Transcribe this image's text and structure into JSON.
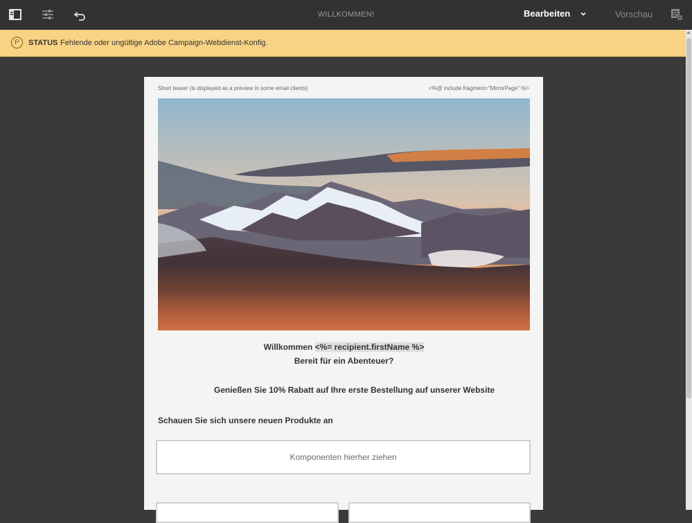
{
  "toolbar": {
    "title": "WILLKOMMEN!",
    "edit_label": "Bearbeiten",
    "preview_label": "Vorschau",
    "icons": [
      "sidebar-toggle-icon",
      "properties-sliders-icon",
      "undo-icon",
      "chevron-down-icon",
      "side-panel-icon"
    ]
  },
  "status": {
    "label": "STATUS",
    "message": "Fehlende oder ungültige Adobe Campaign-Webdienst-Konfig."
  },
  "email": {
    "teaser": "Short teaser (is displayed as a preview in some email clients)",
    "mirror": "<%@ include fragment=\"MirrorPage\" %>",
    "greeting_prefix": "Willkommen",
    "greeting_token": "<%= recipient.firstName %>",
    "subtitle": "Bereit für ein Abenteuer?",
    "discount": "Genießen Sie 10% Rabatt auf Ihre erste Bestellung auf unserer Website",
    "products_heading": "Schauen Sie sich unsere neuen Produkte an",
    "dropzone_label": "Komponenten hierher ziehen"
  },
  "colors": {
    "toolbar_bg": "#323232",
    "status_bg": "#f9d384",
    "workspace_bg": "#3a3a3a",
    "email_bg": "#f4f4f4"
  }
}
